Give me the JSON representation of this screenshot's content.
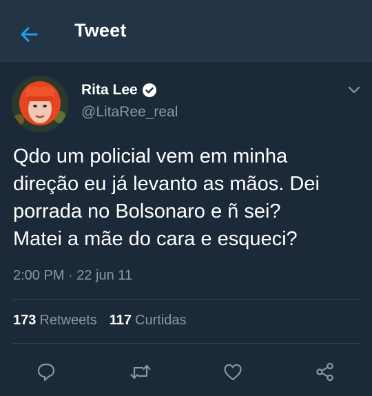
{
  "header": {
    "title": "Tweet",
    "back_icon": "arrow-left-icon",
    "accent_color": "#1da1f2"
  },
  "tweet": {
    "author": {
      "name": "Rita Lee",
      "handle": "@LitaRee_real",
      "verified": true
    },
    "text": "Qdo um policial vem em minha\ndireção eu já levanto as mãos. Dei\nporrada no Bolsonaro e ñ sei?\nMatei a mãe do cara e esqueci?",
    "timestamp": "2:00 PM · 22 jun 11",
    "stats": {
      "retweets_count": "173",
      "retweets_label": "Retweets",
      "likes_count": "117",
      "likes_label": "Curtidas"
    }
  },
  "actions": [
    {
      "icon": "reply-icon"
    },
    {
      "icon": "retweet-icon"
    },
    {
      "icon": "like-icon"
    },
    {
      "icon": "share-icon"
    }
  ],
  "colors": {
    "background": "#1c2938",
    "header_background": "#243447",
    "secondary_text": "#8899a6",
    "divider": "#38444d"
  }
}
